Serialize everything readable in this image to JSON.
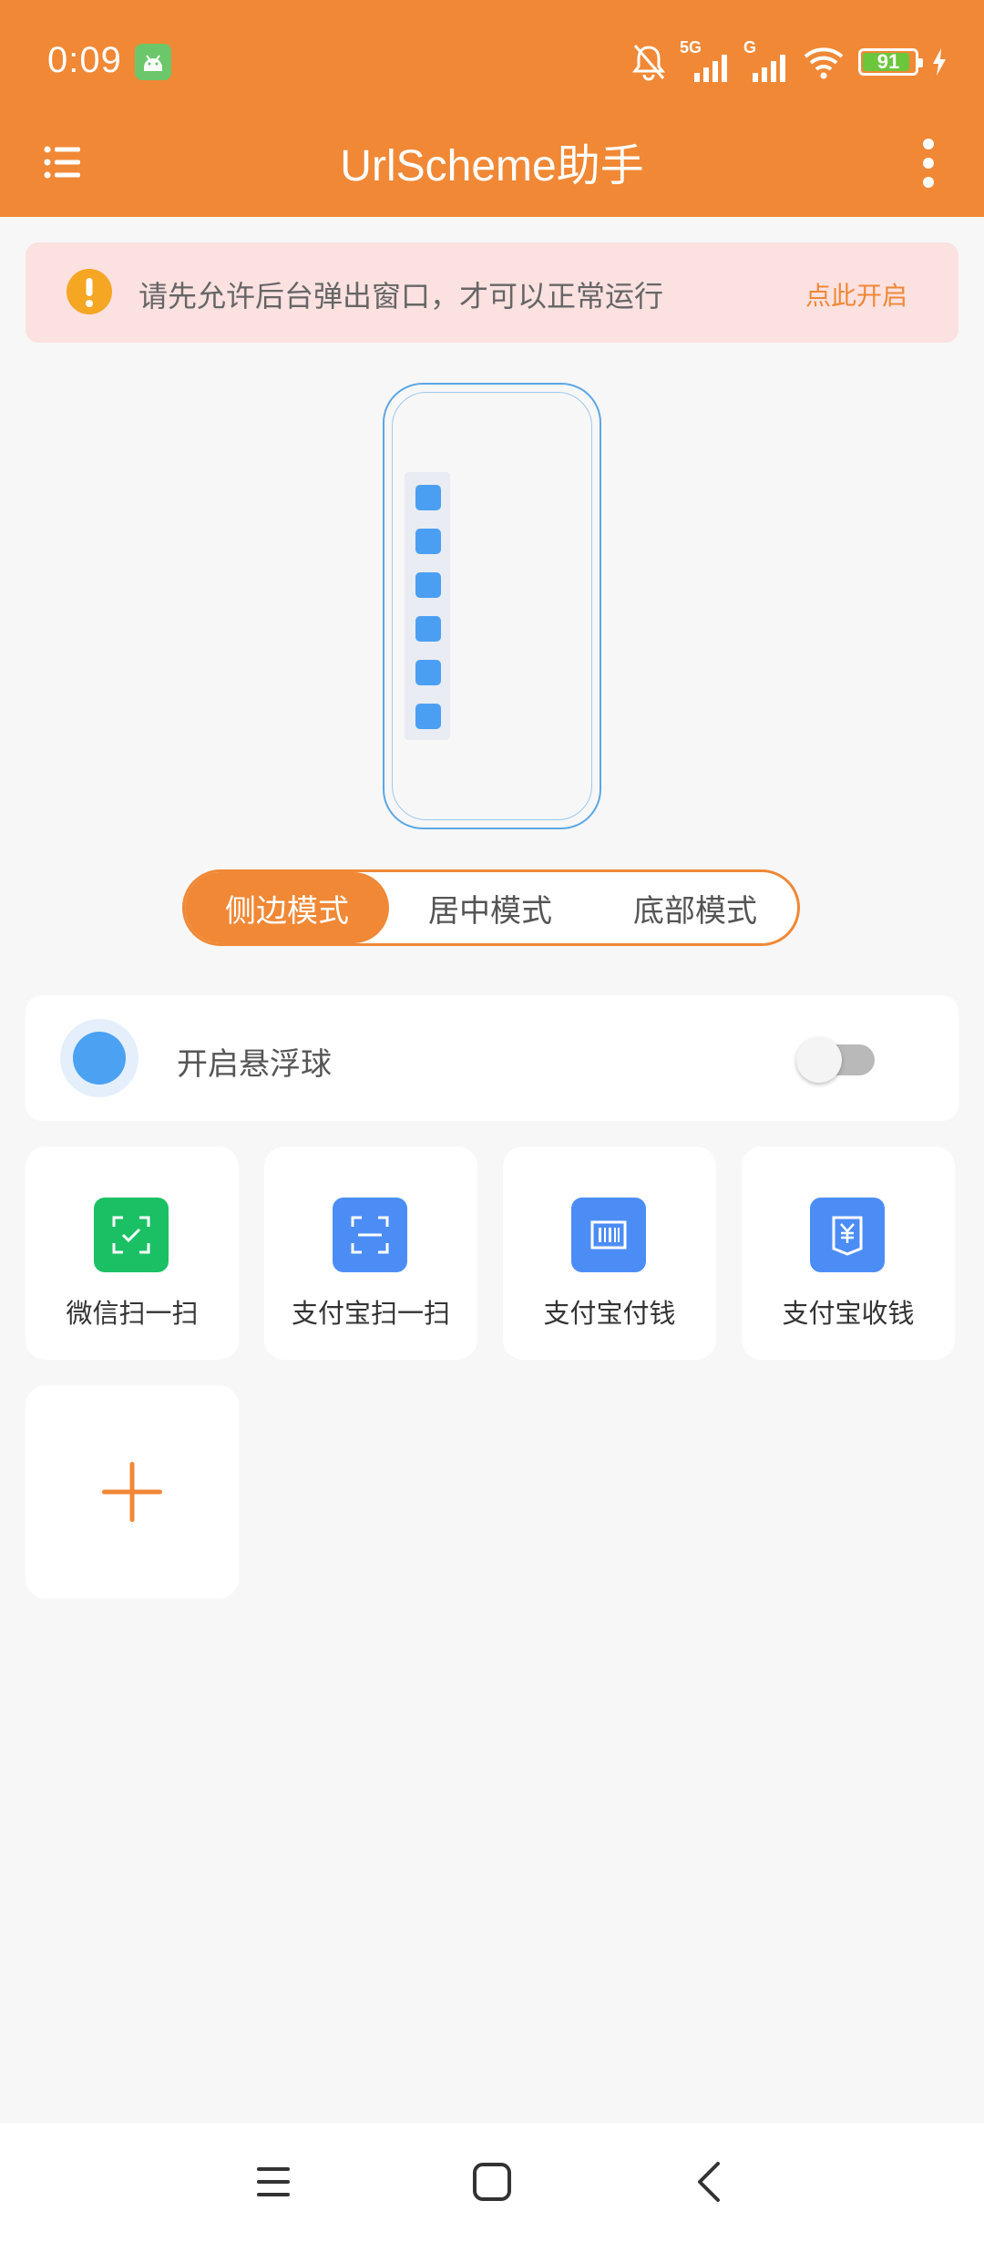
{
  "status_bar": {
    "time": "0:09",
    "network_1": "5G",
    "network_2": "G",
    "battery": "91"
  },
  "app_bar": {
    "title": "UrlScheme助手"
  },
  "banner": {
    "message": "请先允许后台弹出窗口，才可以正常运行",
    "action": "点此开启"
  },
  "preview": {
    "mode": "side",
    "shortcut_slots": 6
  },
  "modes": [
    {
      "label": "侧边模式",
      "selected": true
    },
    {
      "label": "居中模式",
      "selected": false
    },
    {
      "label": "底部模式",
      "selected": false
    }
  ],
  "floating_ball": {
    "label": "开启悬浮球",
    "enabled": false
  },
  "shortcuts": [
    {
      "label": "微信扫一扫",
      "icon": "wechat-scan-icon",
      "color": "#1bc065"
    },
    {
      "label": "支付宝扫一扫",
      "icon": "alipay-scan-icon",
      "color": "#4c8df5"
    },
    {
      "label": "支付宝付钱",
      "icon": "alipay-pay-icon",
      "color": "#4c8df5"
    },
    {
      "label": "支付宝收钱",
      "icon": "alipay-receive-icon",
      "color": "#4c8df5"
    }
  ],
  "colors": {
    "accent": "#f08836",
    "preview_blue": "#4b9ff3",
    "banner_bg": "#fce1e1"
  }
}
